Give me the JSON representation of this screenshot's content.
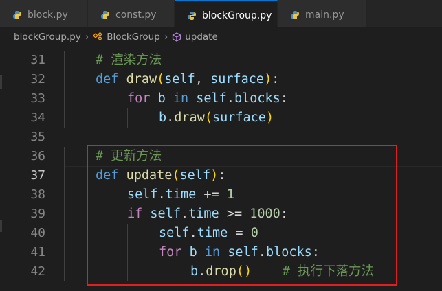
{
  "tabs": [
    {
      "label": "block.py",
      "active": false
    },
    {
      "label": "const.py",
      "active": false
    },
    {
      "label": "blockGroup.py",
      "active": true
    },
    {
      "label": "main.py",
      "active": false
    }
  ],
  "breadcrumb": {
    "file": "blockGroup.py",
    "class": "BlockGroup",
    "method": "update"
  },
  "lines": [
    {
      "n": "31",
      "tokens": [
        [
          "cm",
          "# 渲染方法"
        ]
      ]
    },
    {
      "n": "32",
      "tokens": [
        [
          "kw",
          "def"
        ],
        [
          "",
          " "
        ],
        [
          "fn",
          "draw"
        ],
        [
          "pa",
          "("
        ],
        [
          "var",
          "self"
        ],
        [
          "",
          ", "
        ],
        [
          "var",
          "surface"
        ],
        [
          "pa",
          ")"
        ],
        [
          "",
          ":"
        ]
      ]
    },
    {
      "n": "33",
      "tokens": [
        [
          "ctrl",
          "for"
        ],
        [
          "",
          " "
        ],
        [
          "var",
          "b"
        ],
        [
          "",
          " "
        ],
        [
          "kw",
          "in"
        ],
        [
          "",
          " "
        ],
        [
          "var",
          "self"
        ],
        [
          "",
          "."
        ],
        [
          "var",
          "blocks"
        ],
        [
          "",
          ":"
        ]
      ]
    },
    {
      "n": "34",
      "tokens": [
        [
          "var",
          "b"
        ],
        [
          "",
          "."
        ],
        [
          "fn",
          "draw"
        ],
        [
          "pa",
          "("
        ],
        [
          "var",
          "surface"
        ],
        [
          "pa",
          ")"
        ]
      ]
    },
    {
      "n": "35",
      "tokens": []
    },
    {
      "n": "36",
      "tokens": [
        [
          "cm",
          "# 更新方法"
        ]
      ]
    },
    {
      "n": "37",
      "tokens": [
        [
          "kw",
          "def"
        ],
        [
          "",
          " "
        ],
        [
          "fn",
          "update"
        ],
        [
          "pa",
          "("
        ],
        [
          "var",
          "self"
        ],
        [
          "pa",
          ")"
        ],
        [
          "",
          ":"
        ]
      ]
    },
    {
      "n": "38",
      "tokens": [
        [
          "var",
          "self"
        ],
        [
          "",
          "."
        ],
        [
          "var",
          "time"
        ],
        [
          "",
          " += "
        ],
        [
          "num",
          "1"
        ]
      ]
    },
    {
      "n": "39",
      "tokens": [
        [
          "ctrl",
          "if"
        ],
        [
          "",
          " "
        ],
        [
          "var",
          "self"
        ],
        [
          "",
          "."
        ],
        [
          "var",
          "time"
        ],
        [
          "",
          " >= "
        ],
        [
          "num",
          "1000"
        ],
        [
          "",
          ":"
        ]
      ]
    },
    {
      "n": "40",
      "tokens": [
        [
          "var",
          "self"
        ],
        [
          "",
          "."
        ],
        [
          "var",
          "time"
        ],
        [
          "",
          " = "
        ],
        [
          "num",
          "0"
        ]
      ]
    },
    {
      "n": "41",
      "tokens": [
        [
          "ctrl",
          "for"
        ],
        [
          "",
          " "
        ],
        [
          "var",
          "b"
        ],
        [
          "",
          " "
        ],
        [
          "kw",
          "in"
        ],
        [
          "",
          " "
        ],
        [
          "var",
          "self"
        ],
        [
          "",
          "."
        ],
        [
          "var",
          "blocks"
        ],
        [
          "",
          ":"
        ]
      ]
    },
    {
      "n": "42",
      "tokens": [
        [
          "var",
          "b"
        ],
        [
          "",
          "."
        ],
        [
          "fn",
          "drop"
        ],
        [
          "pa",
          "()"
        ],
        [
          "",
          "    "
        ],
        [
          "cm",
          "# 执行下落方法"
        ]
      ]
    }
  ],
  "current_line": "37",
  "colors": {
    "highlight_box": "#e02020",
    "active_tab_border": "#0078d4"
  }
}
